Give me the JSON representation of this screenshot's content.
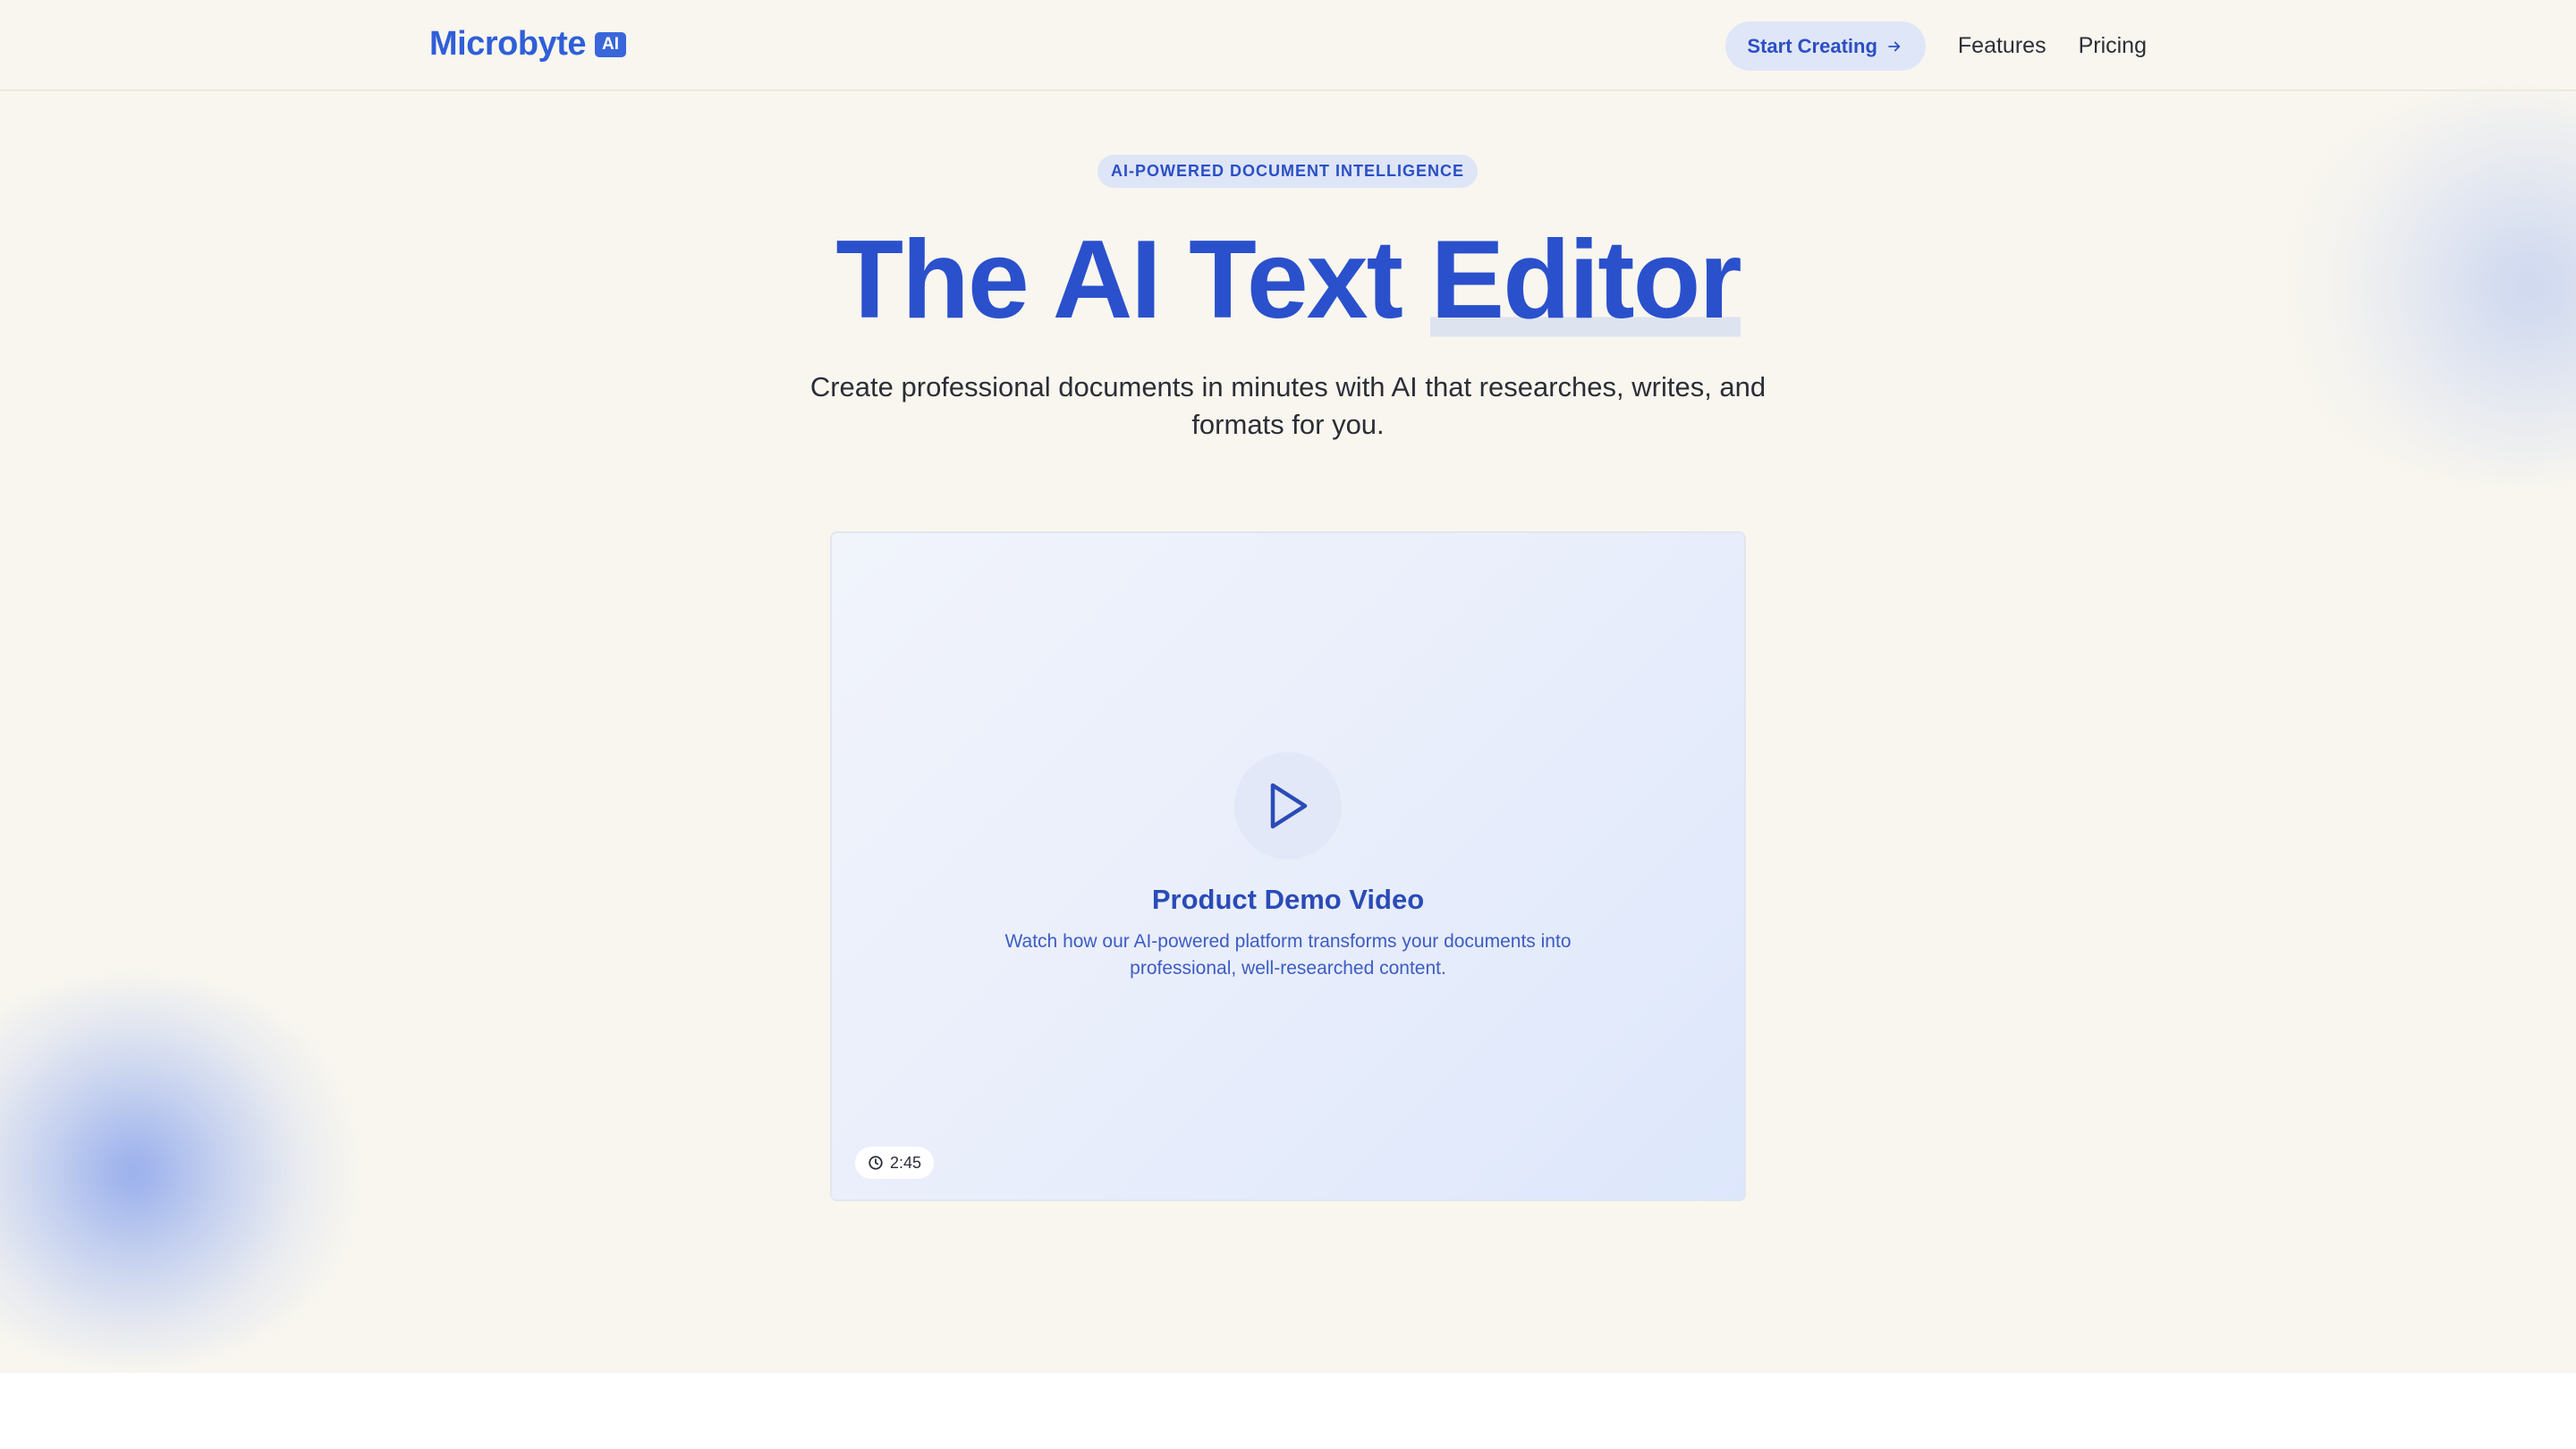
{
  "header": {
    "logo_text": "Microbyte",
    "logo_badge": "AI",
    "start_button_label": "Start Creating",
    "nav_links": [
      "Features",
      "Pricing"
    ]
  },
  "hero": {
    "eyebrow": "AI-POWERED DOCUMENT INTELLIGENCE",
    "headline_main": "The AI Text ",
    "headline_highlight": "Editor",
    "subheadline": "Create professional documents in minutes with AI that researches, writes, and formats for you."
  },
  "video": {
    "title": "Product Demo Video",
    "description": "Watch how our AI-powered platform transforms your documents into professional, well-researched content.",
    "duration": "2:45"
  },
  "icons": {
    "start_button_icon": "arrow-right-icon",
    "play_icon": "play-icon",
    "duration_icon": "clock-icon"
  },
  "colors": {
    "brand_blue": "#2a50cc",
    "page_background": "#f8f6ef",
    "button_background": "#dfe6f8"
  }
}
